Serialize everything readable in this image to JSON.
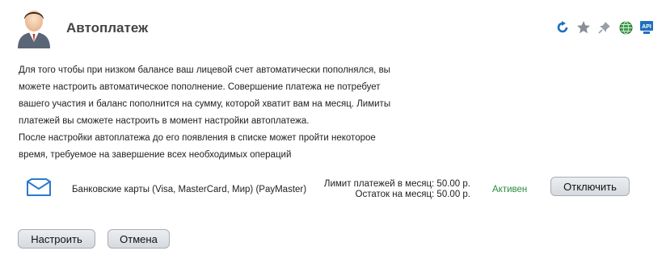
{
  "header": {
    "title": "Автоплатеж",
    "toolbar": [
      {
        "icon": "refresh-icon"
      },
      {
        "icon": "star-icon"
      },
      {
        "icon": "pin-icon"
      },
      {
        "icon": "globe-icon"
      },
      {
        "icon": "api-icon",
        "label": "API"
      }
    ]
  },
  "description": [
    "Для того чтобы при низком балансе ваш лицевой счет автоматически пополнялся, вы",
    "можете настроить автоматическое пополнение. Совершение платежа не потребует",
    "вашего участия и баланс пополнится на сумму, которой хватит вам на месяц. Лимиты",
    "платежей вы сможете настроить в момент настройки автоплатежа.",
    "После настройки автоплатежа до его появления в списке может пройти некоторое",
    "время, требуемое на завершение всех необходимых операций"
  ],
  "payment": {
    "icon": "bank-card-icon",
    "method": "Банковские карты (Visa, MasterCard, Мир) (PayMaster)",
    "limit": "Лимит платежей в месяц: 50.00 р.",
    "remaining": "Остаток на месяц: 50.00 р.",
    "status": "Активен",
    "disable_label": "Отключить"
  },
  "actions": {
    "setup_label": "Настроить",
    "cancel_label": "Отмена"
  },
  "colors": {
    "status_active": "#2e8b3d",
    "icon_blue": "#1f6fbf",
    "title_gray": "#444444"
  }
}
